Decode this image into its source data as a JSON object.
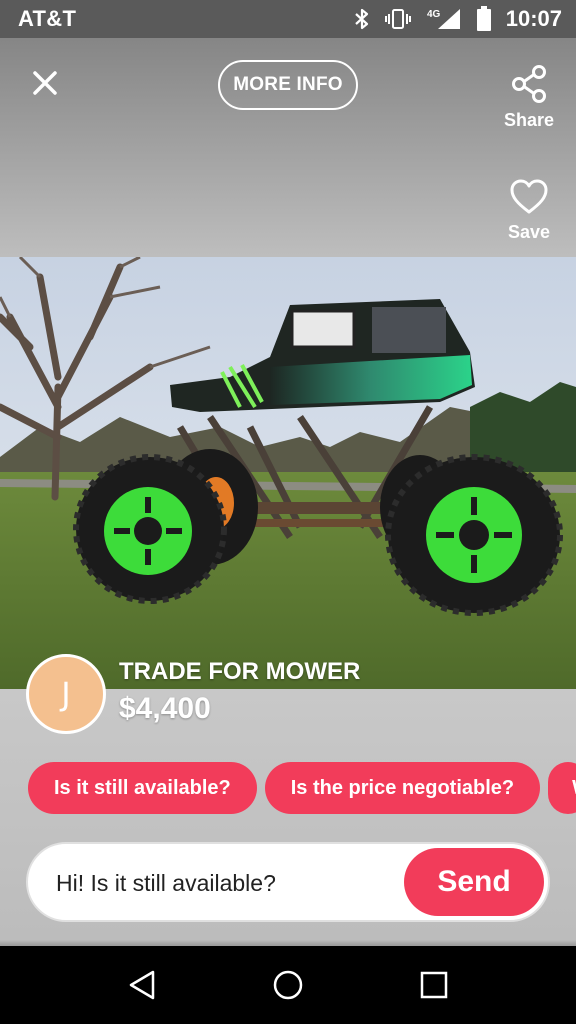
{
  "status_bar": {
    "carrier": "AT&T",
    "network": "4G LTE",
    "time": "10:07"
  },
  "header": {
    "close_icon": "close-icon",
    "more_info_label": "MORE INFO",
    "share_label": "Share",
    "save_label": "Save"
  },
  "listing": {
    "seller_initial": "J",
    "avatar_color": "#f4c08f",
    "title": "TRADE FOR MOWER",
    "price": "$4,400"
  },
  "quick_replies": [
    "Is it still available?",
    "Is the price negotiable?",
    "W"
  ],
  "composer": {
    "message": "Hi! Is it still available?",
    "send_label": "Send"
  },
  "colors": {
    "accent": "#f23c5a",
    "status_bar": "#5a5a5a",
    "nav_bar": "#000000"
  },
  "nav": {
    "back_icon": "back-triangle-icon",
    "home_icon": "home-circle-icon",
    "recents_icon": "recents-square-icon"
  }
}
